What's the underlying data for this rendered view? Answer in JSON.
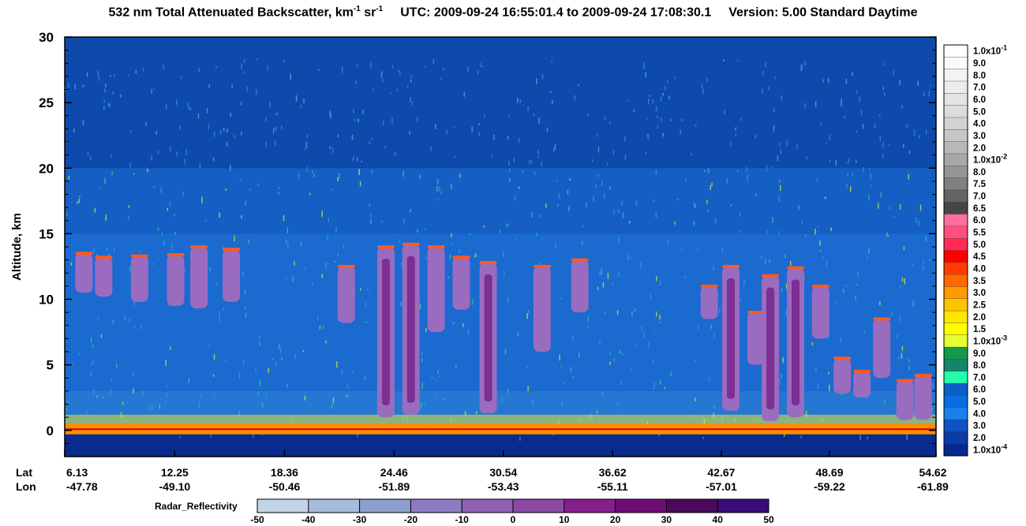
{
  "title": {
    "main": "532 nm Total Attenuated Backscatter, km",
    "unit_exp1": "-1",
    "unit_sr": " sr",
    "unit_exp2": "-1",
    "utc": "UTC:  2009-09-24 16:55:01.4  to  2009-09-24 17:08:30.1",
    "version": "Version: 5.00  Standard  Daytime"
  },
  "chart_data": {
    "type": "heatmap",
    "ylabel": "Altitude, km",
    "ylim": [
      -2,
      30
    ],
    "yticks": [
      0,
      5,
      10,
      15,
      20,
      25,
      30
    ],
    "x_label_lat": "Lat",
    "x_label_lon": "Lon",
    "lat": [
      "6.13",
      "12.25",
      "18.36",
      "24.46",
      "30.54",
      "36.62",
      "42.67",
      "48.69",
      "54.62"
    ],
    "lon": [
      "-47.78",
      "-49.10",
      "-50.46",
      "-51.89",
      "-53.43",
      "-55.11",
      "-57.01",
      "-59.22",
      "-61.89"
    ],
    "cloud_features": [
      {
        "lat": 7.2,
        "base": 10.5,
        "top": 13.5
      },
      {
        "lat": 8.3,
        "base": 10.2,
        "top": 13.2
      },
      {
        "lat": 10.3,
        "base": 9.8,
        "top": 13.3
      },
      {
        "lat": 12.3,
        "base": 9.5,
        "top": 13.4
      },
      {
        "lat": 13.6,
        "base": 9.3,
        "top": 14.0
      },
      {
        "lat": 15.4,
        "base": 9.8,
        "top": 13.8
      },
      {
        "lat": 21.8,
        "base": 8.2,
        "top": 12.5
      },
      {
        "lat": 24.0,
        "base": 1.0,
        "top": 14.0
      },
      {
        "lat": 25.4,
        "base": 1.2,
        "top": 14.2
      },
      {
        "lat": 26.8,
        "base": 7.5,
        "top": 14.0
      },
      {
        "lat": 28.2,
        "base": 9.2,
        "top": 13.2
      },
      {
        "lat": 29.7,
        "base": 1.3,
        "top": 12.8
      },
      {
        "lat": 32.7,
        "base": 6.0,
        "top": 12.5
      },
      {
        "lat": 34.8,
        "base": 9.0,
        "top": 13.0
      },
      {
        "lat": 42.0,
        "base": 8.5,
        "top": 11.0
      },
      {
        "lat": 43.2,
        "base": 1.5,
        "top": 12.5
      },
      {
        "lat": 44.6,
        "base": 5.0,
        "top": 9.0
      },
      {
        "lat": 45.4,
        "base": 0.7,
        "top": 11.8
      },
      {
        "lat": 46.8,
        "base": 1.0,
        "top": 12.4
      },
      {
        "lat": 48.2,
        "base": 7.0,
        "top": 11.0
      },
      {
        "lat": 49.4,
        "base": 2.8,
        "top": 5.5
      },
      {
        "lat": 50.5,
        "base": 2.5,
        "top": 4.5
      },
      {
        "lat": 51.6,
        "base": 4.0,
        "top": 8.5
      },
      {
        "lat": 52.9,
        "base": 0.8,
        "top": 3.8
      },
      {
        "lat": 53.9,
        "base": 0.8,
        "top": 4.2
      }
    ],
    "colorbar": {
      "labels": [
        "1.0x10-1",
        "9.0",
        "8.0",
        "7.0",
        "6.0",
        "5.0",
        "4.0",
        "3.0",
        "2.0",
        "1.0x10-2",
        "8.0",
        "7.5",
        "7.0",
        "6.5",
        "6.0",
        "5.5",
        "5.0",
        "4.5",
        "4.0",
        "3.5",
        "3.0",
        "2.5",
        "2.0",
        "1.5",
        "1.0x10-3",
        "9.0",
        "8.0",
        "7.0",
        "6.0",
        "5.0",
        "4.0",
        "3.0",
        "2.0",
        "1.0x10-4"
      ],
      "colors": [
        "#ffffff",
        "#fafafa",
        "#f3f3f3",
        "#ececec",
        "#e4e4e4",
        "#dcdcdc",
        "#d2d2d2",
        "#c6c6c6",
        "#b8b8b8",
        "#a8a8a8",
        "#969696",
        "#808080",
        "#646464",
        "#464646",
        "#ff6f9c",
        "#ff4f7f",
        "#ff2b55",
        "#ff0000",
        "#ff3b00",
        "#ff6a00",
        "#ff9a00",
        "#ffc400",
        "#ffe600",
        "#ffff00",
        "#e6ff32",
        "#129b4d",
        "#11866a",
        "#22ffab",
        "#0c5ec8",
        "#0a6de2",
        "#1a80ec",
        "#0d53c2",
        "#0a3ca6",
        "#07298d"
      ]
    },
    "reflectivity": {
      "label": "Radar_Reflectivity",
      "ticks": [
        "-50",
        "-40",
        "-30",
        "-20",
        "-10",
        "0",
        "10",
        "20",
        "30",
        "40",
        "50"
      ],
      "colors": [
        "#c3d4e6",
        "#a6bcda",
        "#8f9fcd",
        "#8c7dc2",
        "#8e61b0",
        "#8b4aa4",
        "#851f8e",
        "#6c0e76",
        "#4a0a5a",
        "#3a0b7a"
      ]
    }
  }
}
